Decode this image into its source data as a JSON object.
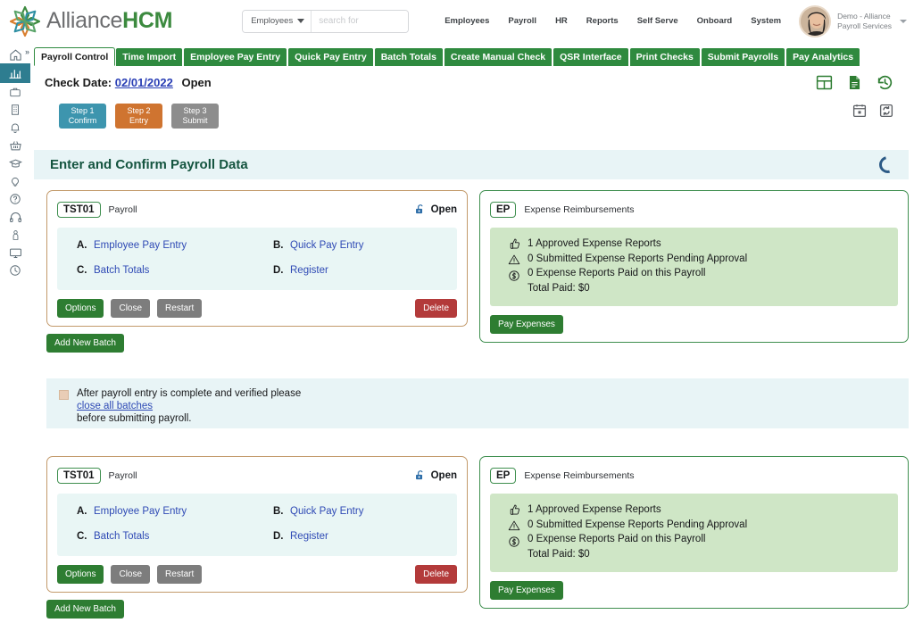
{
  "brand": {
    "name_part1": "Alliance",
    "name_part2": "HCM",
    "logo_icon": "starburst-logo",
    "accent_green": "#2f8a3f",
    "accent_teal": "#2e7d90",
    "accent_orange": "#cf7430"
  },
  "search": {
    "scope_value": "Employees",
    "placeholder": "search for",
    "input_value": ""
  },
  "topnav": {
    "items": [
      {
        "label": "Employees"
      },
      {
        "label": "Payroll"
      },
      {
        "label": "HR"
      },
      {
        "label": "Reports"
      },
      {
        "label": "Self Serve"
      },
      {
        "label": "Onboard"
      },
      {
        "label": "System"
      }
    ]
  },
  "user": {
    "line1": "Demo - Alliance",
    "line2": "Payroll Services",
    "avatar_icon": "user-avatar"
  },
  "sidebar": {
    "expand_glyph": "»",
    "items": [
      {
        "icon": "home-icon",
        "active": false
      },
      {
        "icon": "analytics-chart-icon",
        "active": true
      },
      {
        "icon": "briefcase-icon",
        "active": false
      },
      {
        "icon": "building-icon",
        "active": false
      },
      {
        "icon": "bell-icon",
        "active": false
      },
      {
        "icon": "basket-icon",
        "active": false
      },
      {
        "icon": "graduation-cap-icon",
        "active": false
      },
      {
        "icon": "lightbulb-icon",
        "active": false
      },
      {
        "icon": "question-circle-icon",
        "active": false
      },
      {
        "icon": "headset-icon",
        "active": false
      },
      {
        "icon": "person-icon",
        "active": false
      },
      {
        "icon": "monitor-icon",
        "active": false
      },
      {
        "icon": "clock-icon",
        "active": false
      }
    ]
  },
  "tabs": [
    {
      "label": "Payroll Control",
      "active": true
    },
    {
      "label": "Time Import",
      "active": false
    },
    {
      "label": "Employee Pay Entry",
      "active": false
    },
    {
      "label": "Quick Pay Entry",
      "active": false
    },
    {
      "label": "Batch Totals",
      "active": false
    },
    {
      "label": "Create Manual Check",
      "active": false
    },
    {
      "label": "QSR Interface",
      "active": false
    },
    {
      "label": "Print Checks",
      "active": false
    },
    {
      "label": "Submit Payrolls",
      "active": false
    },
    {
      "label": "Pay Analytics",
      "active": false
    }
  ],
  "check_date": {
    "label": "Check Date:",
    "value": "02/01/2022",
    "status": "Open"
  },
  "header_icons_row1": [
    {
      "icon": "grid-table-icon"
    },
    {
      "icon": "document-icon"
    },
    {
      "icon": "history-clock-icon"
    }
  ],
  "header_icons_row2": [
    {
      "icon": "calendar-icon"
    },
    {
      "icon": "refresh-sync-icon"
    }
  ],
  "steps": [
    {
      "line1": "Step 1",
      "line2": "Confirm",
      "color": "#3d95ae"
    },
    {
      "line1": "Step 2",
      "line2": "Entry",
      "color": "#cf7430"
    },
    {
      "line1": "Step 3",
      "line2": "Submit",
      "color": "#8d8d8d"
    }
  ],
  "section": {
    "title": "Enter and Confirm Payroll Data",
    "spinner_icon": "loading-spinner-icon"
  },
  "payroll_card": {
    "code": "TST01",
    "title": "Payroll",
    "status": "Open",
    "status_icon": "open-padlock-icon",
    "links_left": [
      {
        "letter": "A.",
        "label": "Employee Pay Entry"
      },
      {
        "letter": "C.",
        "label": "Batch Totals"
      }
    ],
    "links_right": [
      {
        "letter": "B.",
        "label": "Quick Pay Entry"
      },
      {
        "letter": "D.",
        "label": "Register"
      }
    ],
    "buttons": {
      "options": "Options",
      "close": "Close",
      "restart": "Restart",
      "delete": "Delete"
    },
    "add_new_batch": "Add New Batch"
  },
  "expense_card": {
    "code": "EP",
    "title": "Expense Reimbursements",
    "stats": [
      {
        "icon": "thumbs-up-icon",
        "text": "1 Approved Expense Reports"
      },
      {
        "icon": "warning-triangle-icon",
        "text": "0 Submitted Expense Reports Pending Approval"
      },
      {
        "icon": "dollar-circle-icon",
        "text": "0 Expense Reports Paid on this Payroll"
      },
      {
        "icon": "",
        "text": "Total Paid: $0"
      }
    ],
    "pay_button": "Pay Expenses"
  },
  "notice": {
    "icon": "note-icon",
    "line1": "After payroll entry is complete and verified please",
    "link": "close all batches",
    "line2": "before submitting payroll."
  }
}
